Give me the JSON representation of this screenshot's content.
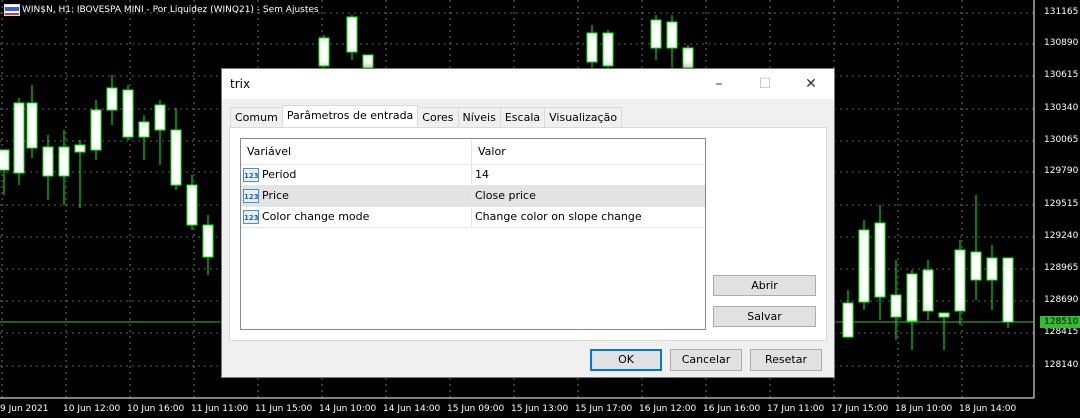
{
  "chart": {
    "title": "WIN$N, H1:  IBOVESPA MINI - Por Liquidez (WINQ21) - Sem Ajustes",
    "price_labels": [
      "131165",
      "130890",
      "130615",
      "130340",
      "130065",
      "129790",
      "129515",
      "129240",
      "128965",
      "128690",
      "128415",
      "128140"
    ],
    "current_price": "128510",
    "time_labels": [
      "9 Jun 2021",
      "10 Jun 12:00",
      "10 Jun 16:00",
      "11 Jun 11:00",
      "11 Jun 15:00",
      "14 Jun 10:00",
      "14 Jun 14:00",
      "15 Jun 09:00",
      "15 Jun 13:00",
      "15 Jun 17:00",
      "16 Jun 12:00",
      "16 Jun 16:00",
      "17 Jun 11:00",
      "17 Jun 15:00",
      "18 Jun 10:00",
      "18 Jun 14:00"
    ],
    "colors": {
      "background": "#000000",
      "grid": "#c0c0c0",
      "candle": "#00ff00",
      "current_line": "#2fbf2f"
    }
  },
  "dialog": {
    "title": "trix",
    "tabs": [
      "Comum",
      "Parâmetros de entrada",
      "Cores",
      "Níveis",
      "Escala",
      "Visualização"
    ],
    "active_tab": 1,
    "table": {
      "headers": [
        "Variável",
        "Valor"
      ],
      "rows": [
        {
          "name": "Period",
          "value": "14",
          "icon": "numeric-123-icon"
        },
        {
          "name": "Price",
          "value": "Close price",
          "icon": "numeric-123-icon"
        },
        {
          "name": "Color change mode",
          "value": "Change color on slope change",
          "icon": "numeric-123-icon"
        }
      ],
      "selected_row": 1
    },
    "icon_text": "123",
    "side_buttons": {
      "open": "Abrir",
      "save": "Salvar"
    },
    "bottom_buttons": {
      "ok": "OK",
      "cancel": "Cancelar",
      "reset": "Resetar"
    },
    "window_controls": {
      "minimize": "–",
      "maximize": "☐",
      "close": "✕"
    }
  }
}
